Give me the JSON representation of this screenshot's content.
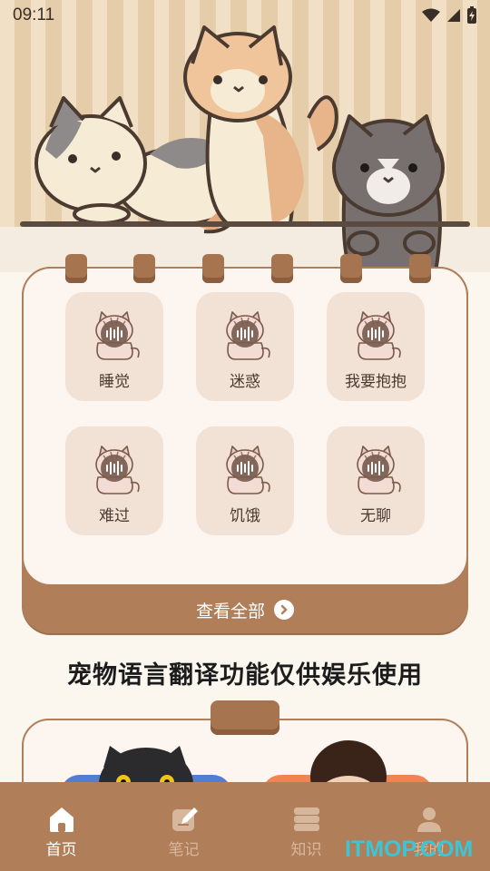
{
  "status_bar": {
    "time": "09:11"
  },
  "sounds": [
    {
      "label": "睡觉"
    },
    {
      "label": "迷惑"
    },
    {
      "label": "我要抱抱"
    },
    {
      "label": "难过"
    },
    {
      "label": "饥饿"
    },
    {
      "label": "无聊"
    }
  ],
  "view_all_label": "查看全部",
  "disclaimer": "宠物语言翻译功能仅供娱乐使用",
  "nav": [
    {
      "label": "首页",
      "icon": "home-icon",
      "active": true
    },
    {
      "label": "笔记",
      "icon": "note-icon",
      "active": false
    },
    {
      "label": "知识",
      "icon": "book-icon",
      "active": false
    },
    {
      "label": "我的",
      "icon": "user-icon",
      "active": false
    }
  ],
  "watermark": "ITMOP.COM",
  "colors": {
    "accent_brown": "#b07f5a",
    "card_bg": "#fdf5ef",
    "tile_bg": "#f2e2d6",
    "watermark": "#3bc6d8"
  }
}
